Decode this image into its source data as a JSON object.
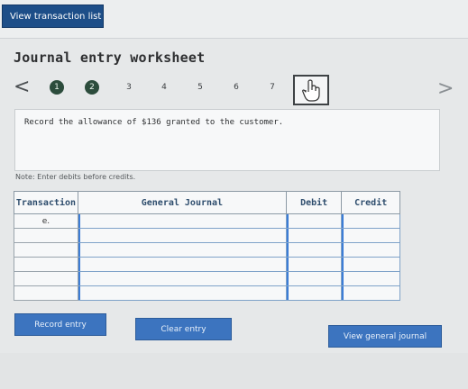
{
  "header": {
    "view_transaction_list": "View transaction list"
  },
  "worksheet": {
    "title": "Journal entry worksheet"
  },
  "steps": {
    "prev_arrow": "<",
    "next_arrow": ">",
    "items": [
      "1",
      "2",
      "3",
      "4",
      "5",
      "6",
      "7"
    ],
    "completed": [
      "1",
      "2"
    ],
    "current_icon": "pointing-hand-icon"
  },
  "prompt": {
    "text": "Record the allowance of $136 granted to the customer."
  },
  "note": "Note: Enter debits before credits.",
  "journal": {
    "headers": {
      "transaction": "Transaction",
      "general_journal": "General Journal",
      "debit": "Debit",
      "credit": "Credit"
    },
    "rows": [
      {
        "transaction": "e.",
        "account": "",
        "debit": "",
        "credit": ""
      },
      {
        "transaction": "",
        "account": "",
        "debit": "",
        "credit": ""
      },
      {
        "transaction": "",
        "account": "",
        "debit": "",
        "credit": ""
      },
      {
        "transaction": "",
        "account": "",
        "debit": "",
        "credit": ""
      },
      {
        "transaction": "",
        "account": "",
        "debit": "",
        "credit": ""
      },
      {
        "transaction": "",
        "account": "",
        "debit": "",
        "credit": ""
      }
    ]
  },
  "buttons": {
    "record_entry": "Record entry",
    "clear_entry": "Clear entry",
    "view_general_journal": "View general journal"
  },
  "colors": {
    "primary_button": "#3c74bf",
    "header_button": "#1d4e88",
    "completed_step": "#2c4c3c",
    "input_border": "#3d7dd6"
  }
}
